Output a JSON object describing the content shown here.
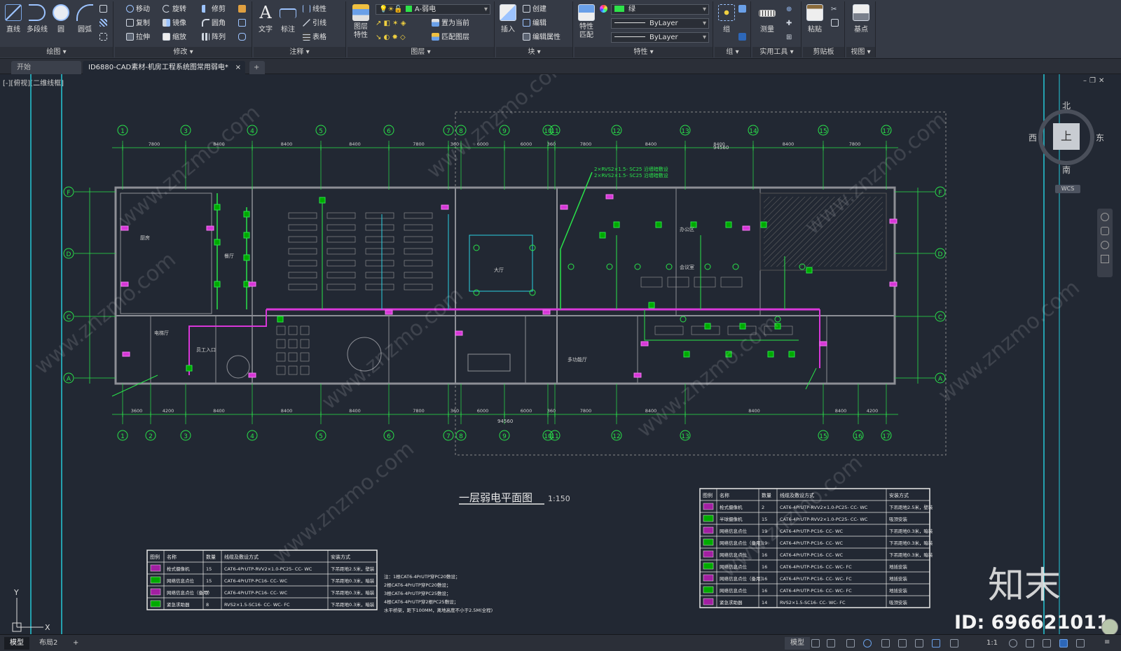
{
  "ribbon": {
    "draw": {
      "footer": "绘图 ▾",
      "line": "直线",
      "polyline": "多段线",
      "circle": "圆",
      "arc": "圆弧"
    },
    "modify": {
      "footer": "修改 ▾",
      "move": "移动",
      "rotate": "旋转",
      "trim": "修剪",
      "copy": "复制",
      "mirror": "镜像",
      "fillet": "圆角",
      "stretch": "拉伸",
      "scale": "缩放",
      "array": "阵列"
    },
    "annotation": {
      "footer": "注释 ▾",
      "text": "文字",
      "dimension": "标注",
      "linear": "线性",
      "leader": "引线",
      "table": "表格"
    },
    "layers": {
      "footer": "图层 ▾",
      "layer_props": "图层\n特性",
      "current_layer": "A-弱电",
      "make_current": "置为当前",
      "match_layer": "匹配图层"
    },
    "block": {
      "footer": "块 ▾",
      "insert": "插入",
      "create": "创建",
      "edit": "编辑",
      "edit_attr": "编辑属性"
    },
    "properties": {
      "footer": "特性 ▾",
      "match": "特性\n匹配",
      "color": "绿",
      "linetype": "ByLayer",
      "lineweight": "ByLayer"
    },
    "groups": {
      "footer": "组 ▾",
      "group": "组"
    },
    "utilities": {
      "footer": "实用工具 ▾",
      "measure": "测量"
    },
    "clipboard": {
      "footer": "剪贴板",
      "paste": "粘贴"
    },
    "view": {
      "footer": "视图 ▾",
      "base": "基点"
    }
  },
  "tabs": {
    "start": "开始",
    "file": "ID6880-CAD素材-机房工程系统图常用弱电*",
    "close": "×",
    "add": "+"
  },
  "viewport": {
    "label": "[-][俯视][二维线框]"
  },
  "viewcube": {
    "north": "北",
    "south": "南",
    "east": "东",
    "west": "西",
    "top": "上",
    "wcs": "WCS"
  },
  "drawing": {
    "title": "一层弱电平面图",
    "scale": "1:150",
    "grid_top": [
      "1",
      "3",
      "4",
      "5",
      "6",
      "7",
      "8",
      "9",
      "10",
      "11",
      "12",
      "13",
      "14",
      "15",
      "17"
    ],
    "grid_bottom": [
      "1",
      "2",
      "3",
      "4",
      "5",
      "6",
      "7",
      "8",
      "9",
      "10",
      "11",
      "12",
      "13",
      "15",
      "16",
      "17"
    ],
    "grid_rows": [
      "F",
      "D",
      "C",
      "A"
    ],
    "dims_top": [
      "7800",
      "8400",
      "8400",
      "8400",
      "7800",
      "360",
      "6000",
      "6000",
      "360",
      "7800",
      "8400",
      "8400",
      "8400",
      "7800"
    ],
    "dims_bottom": [
      "3600",
      "4200",
      "8400",
      "8400",
      "8400",
      "7800",
      "360",
      "6000",
      "6000",
      "360",
      "7800",
      "8400",
      "8400",
      "8400",
      "4200",
      "3600"
    ],
    "total_dim": "94560",
    "rooms": [
      "大厅",
      "餐厅",
      "办公区",
      "会议室",
      "电梯厅",
      "员工入口",
      "厨房",
      "多功能厅"
    ],
    "note_cable": "2×RVS2×1.5- SC25 沿墙暗敷设",
    "left_legend": {
      "headers": [
        "图例",
        "名称",
        "数量",
        "线缆及敷设方式",
        "安装方式"
      ],
      "rows": [
        [
          "",
          "枪式摄像机",
          "15",
          "CAT6-4PrUTP-RVV2×1.0-PC25- CC- WC",
          "下吊距地2.5米，壁装"
        ],
        [
          "",
          "网络信息点位",
          "15",
          "CAT6-4PrUTP-PC16- CC- WC",
          "下吊距地0.3米，暗装"
        ],
        [
          "",
          "网络信息点位（备用）",
          "7",
          "CAT6-4PrUTP-PC16- CC- WC",
          "下吊距地0.3米，暗装"
        ],
        [
          "",
          "紧急求助器",
          "8",
          "RVS2×1.5-SC16- CC- WC- FC",
          "下吊距地0.3米，暗装"
        ]
      ],
      "notes": [
        "注：1根CAT6-4PrUTP穿PC20敷设；",
        "2根CAT6-4PrUTP穿PC20敷设；",
        "3根CAT6-4PrUTP穿PC25敷设；",
        "4根CAT6-4PrUTP穿2根PC25敷设；",
        "水平桥架，距下100MM，离地高度不小于2.5M(全程)"
      ]
    },
    "right_legend": {
      "headers": [
        "图例",
        "名称",
        "数量",
        "线缆及敷设方式",
        "安装方式"
      ],
      "rows": [
        [
          "",
          "枪式摄像机",
          "2",
          "CAT6-4PrUTP-RVV2×1.0-PC25- CC- WC",
          "下吊距地2.5米，壁装"
        ],
        [
          "",
          "半球摄像机",
          "15",
          "CAT6-4PrUTP-RVV2×1.0-PC25- CC- WC",
          "吸顶安装"
        ],
        [
          "",
          "网络信息点位",
          "19",
          "CAT6-4PrUTP-PC16- CC- WC",
          "下吊距地0.3米，暗装"
        ],
        [
          "",
          "网络信息点位（备用）",
          "19",
          "CAT6-4PrUTP-PC16- CC- WC",
          "下吊距地0.3米，暗装"
        ],
        [
          "",
          "网络信息点位",
          "16",
          "CAT6-4PrUTP-PC16- CC- WC",
          "下吊距地0.3米，暗装"
        ],
        [
          "",
          "网络信息点位",
          "16",
          "CAT6-4PrUTP-PC16- CC- WC- FC",
          "地插安装"
        ],
        [
          "",
          "网络信息点位（备用）",
          "16",
          "CAT6-4PrUTP-PC16- CC- WC- FC",
          "地插安装"
        ],
        [
          "",
          "网络信息点位",
          "16",
          "CAT6-4PrUTP-PC16- CC- WC- FC",
          "地插安装"
        ],
        [
          "",
          "紧急求助器",
          "14",
          "RVS2×1.5-SC16- CC- WC- FC",
          "吸顶安装"
        ]
      ]
    }
  },
  "watermark": {
    "logo": "知末",
    "id": "ID: 696621011",
    "text": "www.znzmo.com"
  },
  "status": {
    "model": "模型",
    "layout2": "布局2",
    "add": "+",
    "model_btn": "模型",
    "scale": "1:1"
  },
  "colors": {
    "ribbon_bg": "#353a45",
    "canvas_bg": "#222833",
    "drawing_green": "#29e34a",
    "cable_magenta": "#d837d8",
    "cable_cyan": "#2ad1e0",
    "wall_gray": "#8d8f96"
  }
}
